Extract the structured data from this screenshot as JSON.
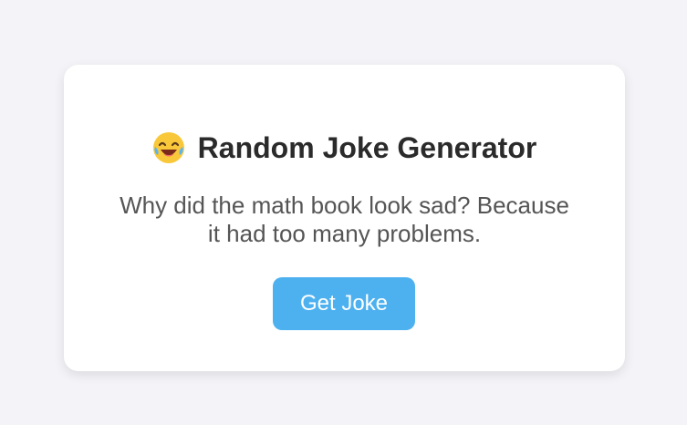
{
  "app": {
    "icon": "laughing-face-icon",
    "title": "Random Joke Generator"
  },
  "joke": {
    "lines": [
      "Why did the math book look sad? Because",
      "it had too many problems."
    ]
  },
  "actions": {
    "get_joke_label": "Get Joke"
  },
  "colors": {
    "page_background": "#f4f4f8",
    "card_background": "#ffffff",
    "title_text": "#2b2b2b",
    "joke_text": "#555555",
    "button_background": "#4db1f0",
    "button_text": "#ffffff"
  }
}
